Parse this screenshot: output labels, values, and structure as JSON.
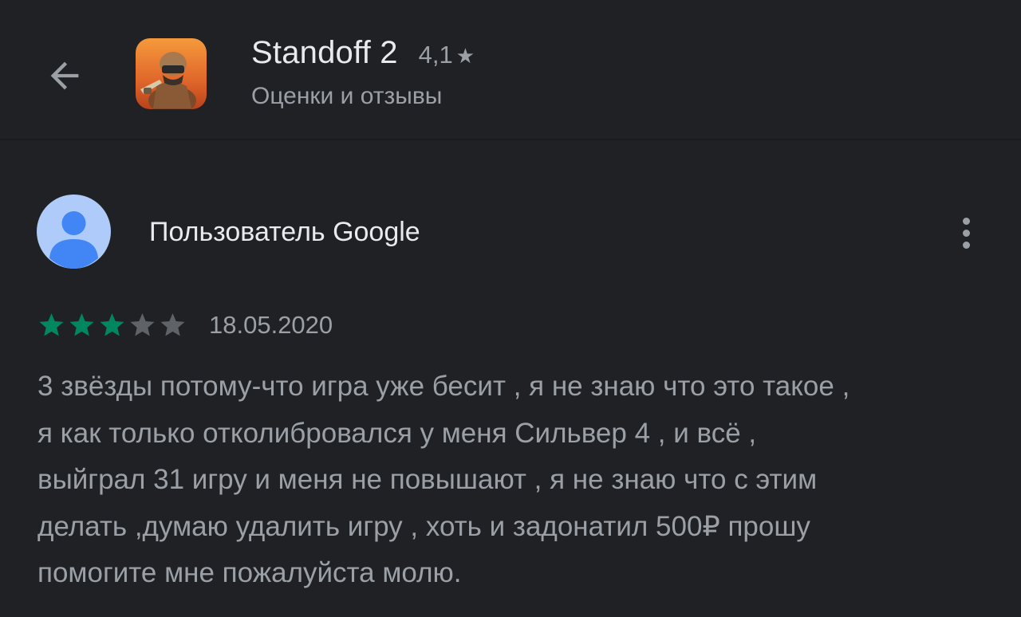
{
  "header": {
    "back_icon": "arrow-left-icon",
    "app_icon": "standoff-2-app-icon",
    "app_title": "Standoff 2",
    "app_rating": "4,1",
    "rating_star": "★",
    "subtitle": "Оценки и отзывы"
  },
  "review": {
    "avatar_icon": "user-avatar-icon",
    "reviewer_name": "Пользователь Google",
    "more_icon": "more-vert-icon",
    "rating": 3,
    "max_rating": 5,
    "date": "18.05.2020",
    "text": "3 звёзды потому-что игра уже бесит , я не знаю что это такое ,\nя как только отколибровался у меня Сильвер 4 , и всё ,\nвыйграл 31 игру и меня не повышают , я не знаю что с этим\nделать ,думаю удалить игру , хоть и задонатил 500₽ прошу\nпомогите мне пожалуйста молю."
  },
  "colors": {
    "background": "#202124",
    "primary_text": "#e8eaed",
    "secondary_text": "#9aa0a6",
    "star_filled": "#01875f",
    "star_empty": "#5f6368",
    "avatar_bg": "#aecbfa",
    "avatar_fg": "#4285f4"
  }
}
